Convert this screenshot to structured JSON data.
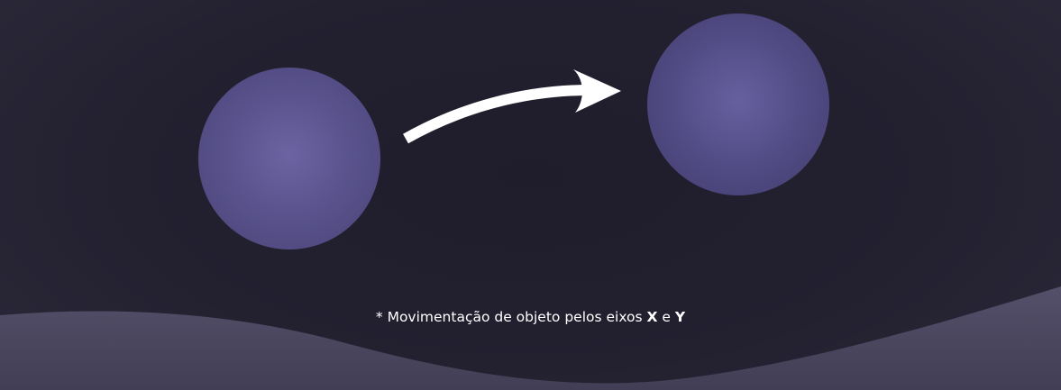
{
  "caption": {
    "prefix": "* Movimentação de objeto pelos eixos ",
    "axis_x": "X",
    "conjunction": " e ",
    "axis_y": "Y"
  },
  "colors": {
    "background": "#201e2c",
    "circle": "#5a538d",
    "arrow": "#ffffff",
    "wave": "#4c4862"
  }
}
